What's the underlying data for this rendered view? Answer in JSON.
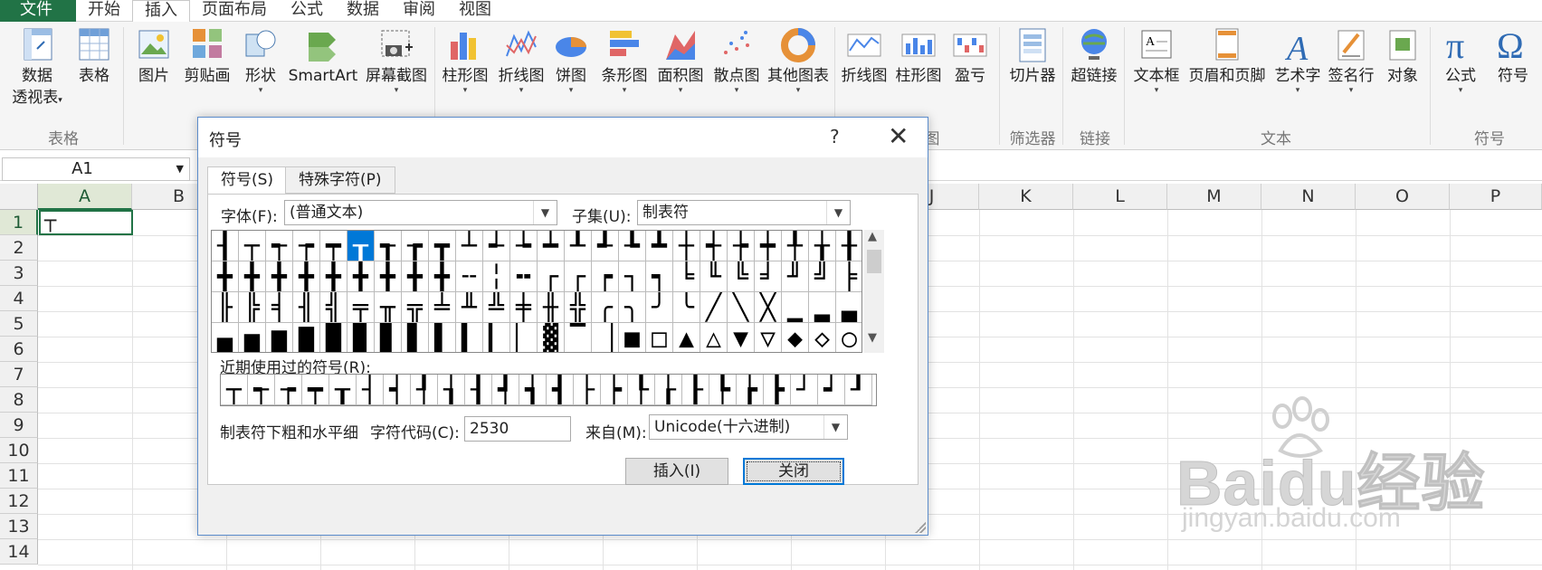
{
  "ribbon_tabs": [
    "文件",
    "开始",
    "插入",
    "页面布局",
    "公式",
    "数据",
    "审阅",
    "视图"
  ],
  "ribbon": {
    "buttons": [
      {
        "label": "数据",
        "label2": "透视表",
        "icon": "pivot-table-icon"
      },
      {
        "label": "表格",
        "icon": "table-icon"
      },
      {
        "label": "图片",
        "icon": "picture-icon"
      },
      {
        "label": "剪贴画",
        "icon": "clipart-icon"
      },
      {
        "label": "形状",
        "icon": "shapes-icon"
      },
      {
        "label": "SmartArt",
        "icon": "smartart-icon"
      },
      {
        "label": "屏幕截图",
        "icon": "screenshot-icon"
      },
      {
        "label": "柱形图",
        "icon": "column-chart-icon"
      },
      {
        "label": "折线图",
        "icon": "line-chart-icon"
      },
      {
        "label": "饼图",
        "icon": "pie-chart-icon"
      },
      {
        "label": "条形图",
        "icon": "bar-chart-icon"
      },
      {
        "label": "面积图",
        "icon": "area-chart-icon"
      },
      {
        "label": "散点图",
        "icon": "scatter-chart-icon"
      },
      {
        "label": "其他图表",
        "icon": "other-chart-icon"
      },
      {
        "label": "折线图",
        "icon": "sparkline-line-icon"
      },
      {
        "label": "柱形图",
        "icon": "sparkline-column-icon"
      },
      {
        "label": "盈亏",
        "icon": "sparkline-winloss-icon"
      },
      {
        "label": "切片器",
        "icon": "slicer-icon"
      },
      {
        "label": "超链接",
        "icon": "hyperlink-icon"
      },
      {
        "label": "文本框",
        "icon": "textbox-icon"
      },
      {
        "label": "页眉和页脚",
        "icon": "header-footer-icon"
      },
      {
        "label": "艺术字",
        "icon": "wordart-icon"
      },
      {
        "label": "签名行",
        "icon": "signature-icon"
      },
      {
        "label": "对象",
        "icon": "object-icon"
      },
      {
        "label": "公式",
        "icon": "equation-icon"
      },
      {
        "label": "符号",
        "icon": "symbol-icon"
      }
    ],
    "groups": [
      "表格",
      "图",
      "筛选器",
      "链接",
      "文本",
      "符号"
    ]
  },
  "namebox": "A1",
  "columns": [
    "A",
    "B",
    "C",
    "D",
    "E",
    "F",
    "G",
    "H",
    "I",
    "J",
    "K",
    "L",
    "M",
    "N",
    "O",
    "P"
  ],
  "rows": [
    "1",
    "2",
    "3",
    "4",
    "5",
    "6",
    "7",
    "8",
    "9",
    "10",
    "11",
    "12",
    "13",
    "14"
  ],
  "cell_a1": "┬",
  "watermark": {
    "main": "Bai☃经验",
    "brand": "Baidu",
    "brand2": "经验",
    "url": "jingyan.baidu.com"
  },
  "dialog": {
    "title": "符号",
    "help": "?",
    "close": "✕",
    "tabs": [
      "符号(S)",
      "特殊字符(P)"
    ],
    "font_label": "字体(F):",
    "font_value": "(普通文本)",
    "subset_label": "子集(U):",
    "subset_value": "制表符",
    "symbols": [
      "┨",
      "┬",
      "┭",
      "┮",
      "┯",
      "┰",
      "┱",
      "┲",
      "┳",
      "┴",
      "┵",
      "┶",
      "┷",
      "┸",
      "┹",
      "┺",
      "┻",
      "┼",
      "┽",
      "┾",
      "┿",
      "╀",
      "╁",
      "╂",
      "╋",
      "╋",
      "╋",
      "╋",
      "╋",
      "╋",
      "╋",
      "╋",
      "╋",
      "╌",
      "╎",
      "╍",
      "┌",
      "┌",
      "┍",
      "┐",
      "┑",
      "╘",
      "╙",
      "╚",
      "╛",
      "╜",
      "╝",
      "╞",
      "╟",
      "╠",
      "╡",
      "╢",
      "╣",
      "╤",
      "╥",
      "╦",
      "╧",
      "╨",
      "╩",
      "╪",
      "╫",
      "╬",
      "╭",
      "╮",
      "╯",
      "╰",
      "╱",
      "╲",
      "╳",
      "▁",
      "▂",
      "▃",
      "▄",
      "▅",
      "▆",
      "▇",
      "█",
      "▉",
      "▊",
      "▋",
      "▌",
      "▍",
      "▎",
      "▏",
      "▓",
      "▔",
      "▕",
      "■",
      "□",
      "▲",
      "△",
      "▼",
      "▽",
      "◆",
      "◇",
      "○"
    ],
    "selected_index": 5,
    "recent_label": "近期使用过的符号(R):",
    "recent": [
      "┬",
      "┭",
      "┮",
      "┯",
      "┰",
      "┤",
      "┥",
      "┦",
      "┧",
      "┨",
      "┩",
      "┪",
      "┫",
      "├",
      "┝",
      "┞",
      "┟",
      "┠",
      "┡",
      "┢",
      "┣",
      "┘",
      "┙",
      "┚"
    ],
    "char_name": "制表符下粗和水平细",
    "code_label": "字符代码(C):",
    "code_value": "2530",
    "from_label": "来自(M):",
    "from_value": "Unicode(十六进制)",
    "insert_label": "插入(I)",
    "close_label": "关闭"
  }
}
